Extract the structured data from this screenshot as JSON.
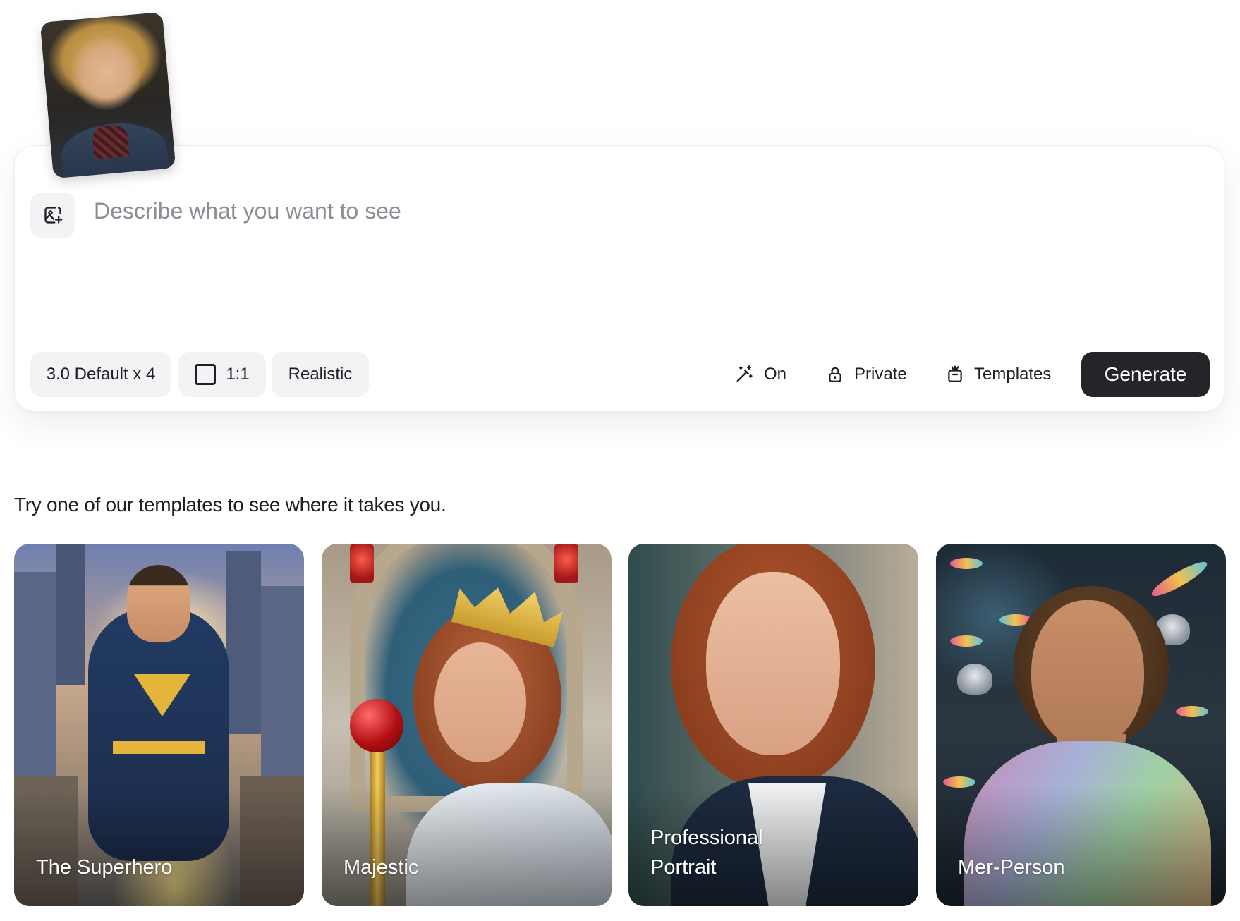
{
  "reference_image": {
    "alt": "Reference photo"
  },
  "prompt": {
    "placeholder": "Describe what you want to see",
    "value": ""
  },
  "options": {
    "model_label": "3.0 Default x 4",
    "ratio_label": "1:1",
    "style_label": "Realistic"
  },
  "tools": {
    "magic_prompt_label": "On",
    "visibility_label": "Private",
    "templates_label": "Templates"
  },
  "generate_label": "Generate",
  "templates_section": {
    "title": "Try one of our templates to see where it takes you.",
    "cards": [
      {
        "label": "The Superhero"
      },
      {
        "label": "Majestic"
      },
      {
        "label": "Professional Portrait"
      },
      {
        "label": "Mer-Person"
      }
    ]
  },
  "icons": {
    "add_image": "image-plus-icon",
    "magic": "magic-wand-icon",
    "lock": "lock-icon",
    "templates": "template-icon"
  },
  "colors": {
    "generate_bg": "#232529",
    "chip_bg": "#f2f3f5",
    "placeholder": "#8b8e95"
  }
}
